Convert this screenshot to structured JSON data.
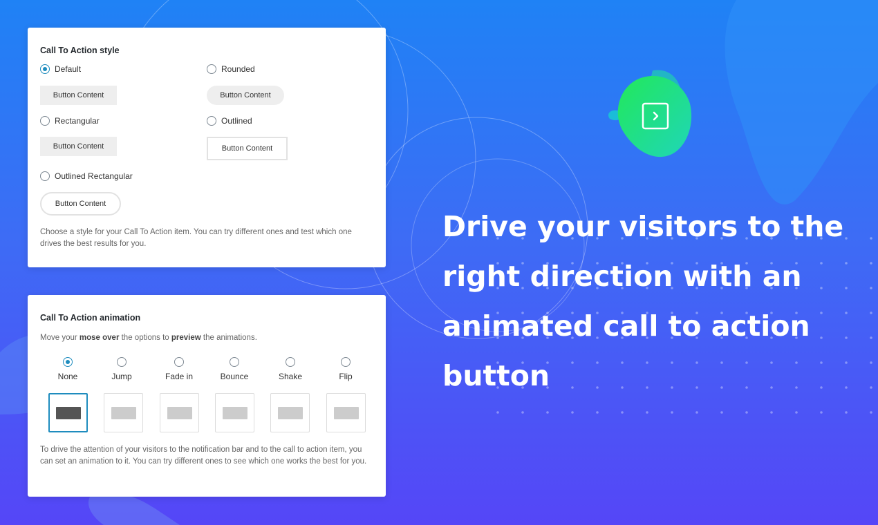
{
  "style_panel": {
    "title": "Call To Action style",
    "options": [
      {
        "label": "Default",
        "checked": true,
        "button_label": "Button Content"
      },
      {
        "label": "Rounded",
        "checked": false,
        "button_label": "Button Content"
      },
      {
        "label": "Rectangular",
        "checked": false,
        "button_label": "Button Content"
      },
      {
        "label": "Outlined",
        "checked": false,
        "button_label": "Button Content"
      },
      {
        "label": "Outlined Rectangular",
        "checked": false,
        "button_label": "Button Content"
      }
    ],
    "help": "Choose a style for your Call To Action item. You can try different ones and test which one drives the best results for you."
  },
  "anim_panel": {
    "title": "Call To Action animation",
    "intro_prefix": "Move your ",
    "intro_bold1": "mose over",
    "intro_mid": " the options to ",
    "intro_bold2": "preview",
    "intro_suffix": " the animations.",
    "options": [
      {
        "label": "None",
        "checked": true
      },
      {
        "label": "Jump",
        "checked": false
      },
      {
        "label": "Fade in",
        "checked": false
      },
      {
        "label": "Bounce",
        "checked": false
      },
      {
        "label": "Shake",
        "checked": false
      },
      {
        "label": "Flip",
        "checked": false
      }
    ],
    "help": "To drive the attention of your visitors to the notification bar and to the call to action item, you can set an animation to it. You can try different ones to see which one works the best for you."
  },
  "hero": {
    "headline": "Drive your visitors to the right direction with an animated call to action button",
    "icon": "chevron-right-icon"
  },
  "colors": {
    "accent": "#1e8cbe",
    "bg_top": "#1f82f5",
    "bg_bottom": "#5546f7",
    "blob_green": "#22e85a"
  }
}
